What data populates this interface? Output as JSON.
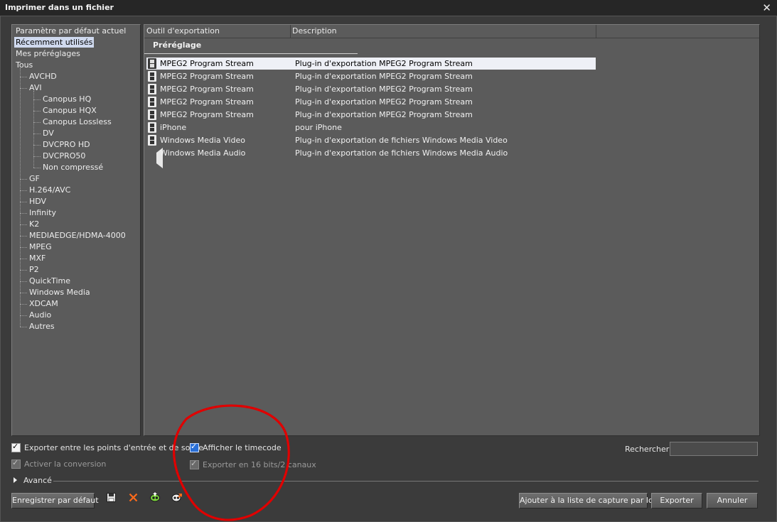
{
  "window": {
    "title": "Imprimer dans un fichier",
    "close_glyph": "✕"
  },
  "tree": {
    "items": [
      {
        "label": "Paramètre par défaut actuel",
        "level": 0,
        "selected": false
      },
      {
        "label": "Récemment utilisés",
        "level": 0,
        "selected": true
      },
      {
        "label": "Mes préréglages",
        "level": 0,
        "selected": false
      },
      {
        "label": "Tous",
        "level": 0,
        "selected": false
      },
      {
        "label": "AVCHD",
        "level": 1,
        "selected": false
      },
      {
        "label": "AVI",
        "level": 1,
        "selected": false
      },
      {
        "label": "Canopus HQ",
        "level": 2,
        "selected": false
      },
      {
        "label": "Canopus HQX",
        "level": 2,
        "selected": false
      },
      {
        "label": "Canopus Lossless",
        "level": 2,
        "selected": false
      },
      {
        "label": "DV",
        "level": 2,
        "selected": false
      },
      {
        "label": "DVCPRO HD",
        "level": 2,
        "selected": false
      },
      {
        "label": "DVCPRO50",
        "level": 2,
        "selected": false
      },
      {
        "label": "Non compressé",
        "level": 2,
        "selected": false
      },
      {
        "label": "GF",
        "level": 1,
        "selected": false
      },
      {
        "label": "H.264/AVC",
        "level": 1,
        "selected": false
      },
      {
        "label": "HDV",
        "level": 1,
        "selected": false
      },
      {
        "label": "Infinity",
        "level": 1,
        "selected": false
      },
      {
        "label": "K2",
        "level": 1,
        "selected": false
      },
      {
        "label": "MEDIAEDGE/HDMA-4000",
        "level": 1,
        "selected": false
      },
      {
        "label": "MPEG",
        "level": 1,
        "selected": false
      },
      {
        "label": "MXF",
        "level": 1,
        "selected": false
      },
      {
        "label": "P2",
        "level": 1,
        "selected": false
      },
      {
        "label": "QuickTime",
        "level": 1,
        "selected": false
      },
      {
        "label": "Windows Media",
        "level": 1,
        "selected": false
      },
      {
        "label": "XDCAM",
        "level": 1,
        "selected": false
      },
      {
        "label": "Audio",
        "level": 1,
        "selected": false
      },
      {
        "label": "Autres",
        "level": 1,
        "selected": false
      }
    ]
  },
  "list": {
    "columns": [
      "Outil d'exportation",
      "Description"
    ],
    "group_label": "Préréglage",
    "rows": [
      {
        "name": "MPEG2 Program Stream",
        "description": "Plug-in d'exportation MPEG2 Program Stream",
        "icon": "film-icon",
        "selected": true
      },
      {
        "name": "MPEG2 Program Stream",
        "description": "Plug-in d'exportation MPEG2 Program Stream",
        "icon": "film-icon",
        "selected": false
      },
      {
        "name": "MPEG2 Program Stream",
        "description": "Plug-in d'exportation MPEG2 Program Stream",
        "icon": "film-icon",
        "selected": false
      },
      {
        "name": "MPEG2 Program Stream",
        "description": "Plug-in d'exportation MPEG2 Program Stream",
        "icon": "film-icon",
        "selected": false
      },
      {
        "name": "MPEG2 Program Stream",
        "description": "Plug-in d'exportation MPEG2 Program Stream",
        "icon": "film-icon",
        "selected": false
      },
      {
        "name": "iPhone",
        "description": "pour iPhone",
        "icon": "film-icon",
        "selected": false
      },
      {
        "name": "Windows Media Video",
        "description": "Plug-in d'exportation de fichiers Windows Media Video",
        "icon": "film-icon",
        "selected": false
      },
      {
        "name": "Windows Media Audio",
        "description": "Plug-in d'exportation de fichiers Windows Media Audio",
        "icon": "speaker-icon",
        "selected": false
      }
    ]
  },
  "options": {
    "export_in_out": {
      "label": "Exporter entre les points d'entrée et de sortie",
      "checked": true,
      "enabled": true
    },
    "enable_conversion": {
      "label": "Activer la conversion",
      "checked": true,
      "enabled": false
    },
    "show_timecode": {
      "label": "Afficher le timecode",
      "checked": true,
      "enabled": true
    },
    "export_16bit": {
      "label": "Exporter en 16 bits/2 canaux",
      "checked": true,
      "enabled": false
    },
    "advanced_label": "Avancé"
  },
  "search": {
    "label": "Rechercher",
    "value": ""
  },
  "toolbar": {
    "save_default_label": "Enregistrer par défaut",
    "icons": [
      "save-icon",
      "delete-icon",
      "import-preset-icon",
      "export-preset-icon"
    ]
  },
  "buttons": {
    "batch_capture": "Ajouter à la liste de capture par lots",
    "export": "Exporter",
    "cancel": "Annuler"
  },
  "colors": {
    "annotation": "#e00000",
    "selection_tree": "#cfd9ee",
    "selection_row": "#eef0f6",
    "checkbox_blue": "#2a6fd6"
  }
}
